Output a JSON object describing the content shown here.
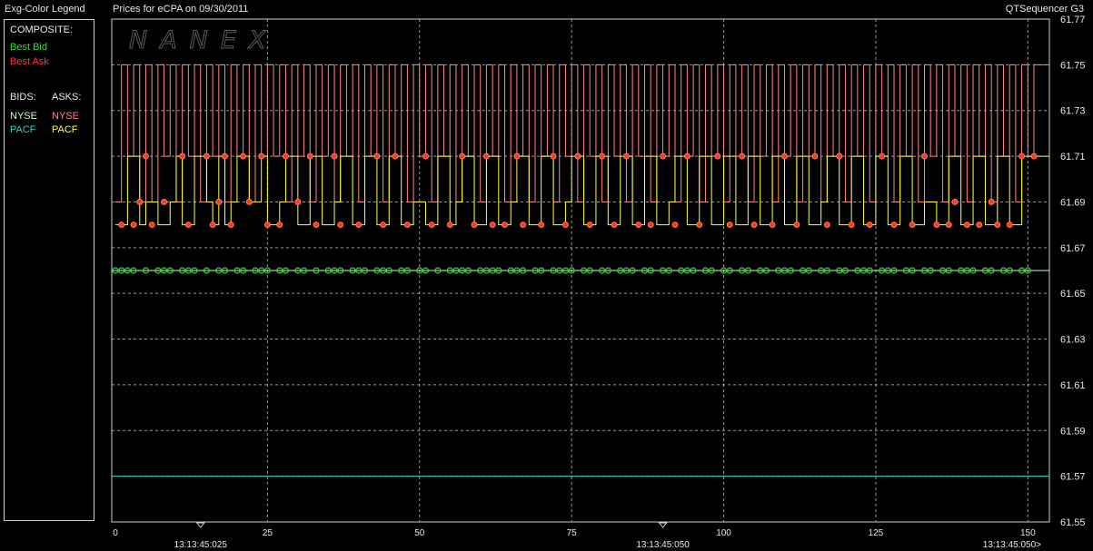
{
  "header": {
    "legend_title": "Exg-Color Legend",
    "chart_title": "Prices for  eCPA  on  09/30/2011",
    "app_name": "QTSequencer G3"
  },
  "legend": {
    "composite_label": "COMPOSITE:",
    "best_bid": "Best Bid",
    "best_ask": "Best Ask",
    "bids_label": "BIDS:",
    "asks_label": "ASKS:",
    "bid_exchanges": [
      "NYSE",
      "PACF"
    ],
    "ask_exchanges": [
      "NYSE",
      "PACF"
    ]
  },
  "colors": {
    "best_bid": "#33dd33",
    "best_ask": "#ff3333",
    "nyse_bid": "#ccffcc",
    "pacf_bid": "#33cccc",
    "nyse_ask": "#ff8888",
    "pacf_ask": "#ffff44",
    "grid": "#cccccc"
  },
  "watermark": "NANEX",
  "chart_data": {
    "type": "line",
    "title": "Prices for  eCPA  on  09/30/2011",
    "xlim": [
      0,
      151
    ],
    "ylim": [
      61.55,
      61.77
    ],
    "y_ticks": [
      "61.77",
      "61.75",
      "61.73",
      "61.71",
      "61.69",
      "61.67",
      "61.65",
      "61.63",
      "61.61",
      "61.59",
      "61.57",
      "61.55"
    ],
    "x_ticks": [
      0,
      25,
      50,
      75,
      100,
      125,
      150
    ],
    "time_labels": [
      {
        "x": 14,
        "label": "13:13:45:025"
      },
      {
        "x": 90,
        "label": "13:13:45:050"
      },
      {
        "x": 151,
        "label": "13:13:45:050>"
      }
    ],
    "grid": true,
    "series": [
      {
        "name": "NYSE",
        "side": "ask",
        "values": [
          61.69,
          61.75,
          61.71,
          61.75,
          61.69,
          61.75,
          61.69,
          61.75,
          61.71,
          61.75,
          61.69,
          61.75,
          61.71,
          61.75,
          61.69,
          61.75,
          61.71,
          61.75,
          61.69,
          61.75,
          61.71,
          61.75,
          61.69,
          61.75,
          61.71,
          61.75,
          61.71,
          61.75,
          61.69,
          61.75,
          61.71,
          61.75,
          61.69,
          61.75,
          61.71,
          61.75,
          61.69,
          61.75,
          61.71,
          61.75,
          61.69,
          61.75,
          61.71,
          61.75,
          61.69,
          61.75,
          61.71,
          61.75,
          61.69,
          61.75,
          61.71,
          61.75,
          61.69,
          61.75,
          61.71,
          61.75,
          61.69,
          61.75,
          61.71,
          61.75,
          61.69,
          61.75,
          61.71,
          61.75,
          61.69,
          61.75,
          61.71,
          61.75,
          61.69,
          61.75,
          61.71,
          61.75,
          61.69,
          61.75,
          61.71,
          61.75,
          61.69,
          61.75,
          61.71,
          61.75,
          61.69,
          61.75,
          61.71,
          61.75,
          61.69,
          61.75,
          61.71,
          61.75,
          61.69,
          61.75,
          61.71,
          61.75,
          61.69,
          61.75,
          61.71,
          61.75,
          61.69,
          61.75,
          61.71,
          61.75,
          61.69,
          61.75,
          61.71,
          61.75,
          61.69,
          61.75,
          61.71,
          61.75,
          61.69,
          61.75,
          61.71,
          61.75,
          61.69,
          61.75,
          61.71,
          61.75,
          61.69,
          61.75,
          61.71,
          61.75,
          61.69,
          61.75,
          61.71,
          61.75,
          61.69,
          61.75,
          61.71,
          61.75,
          61.69,
          61.75,
          61.71,
          61.75,
          61.69,
          61.75,
          61.71,
          61.75,
          61.69,
          61.75,
          61.71,
          61.75,
          61.69,
          61.75,
          61.71,
          61.75,
          61.69,
          61.75,
          61.71,
          61.75,
          61.69,
          61.75,
          61.71,
          61.75
        ]
      },
      {
        "name": "PACF",
        "side": "ask",
        "values": [
          61.68,
          61.68,
          61.71,
          61.71,
          61.68,
          61.69,
          61.69,
          61.68,
          61.68,
          61.69,
          61.71,
          61.68,
          61.68,
          61.71,
          61.71,
          61.69,
          61.68,
          61.71,
          61.68,
          61.69,
          61.71,
          61.71,
          61.69,
          61.69,
          61.71,
          61.68,
          61.68,
          61.69,
          61.71,
          61.71,
          61.68,
          61.68,
          61.71,
          61.71,
          61.68,
          61.68,
          61.69,
          61.71,
          61.71,
          61.68,
          61.68,
          61.71,
          61.71,
          61.68,
          61.68,
          61.71,
          61.71,
          61.68,
          61.68,
          61.69,
          61.69,
          61.68,
          61.68,
          61.71,
          61.71,
          61.68,
          61.69,
          61.71,
          61.71,
          61.68,
          61.68,
          61.71,
          61.71,
          61.68,
          61.68,
          61.69,
          61.71,
          61.71,
          61.68,
          61.68,
          61.71,
          61.71,
          61.68,
          61.68,
          61.69,
          61.71,
          61.71,
          61.68,
          61.68,
          61.71,
          61.71,
          61.68,
          61.68,
          61.71,
          61.71,
          61.68,
          61.68,
          61.71,
          61.71,
          61.68,
          61.68,
          61.69,
          61.71,
          61.71,
          61.68,
          61.68,
          61.71,
          61.71,
          61.68,
          61.68,
          61.71,
          61.71,
          61.68,
          61.68,
          61.71,
          61.71,
          61.68,
          61.68,
          61.71,
          61.71,
          61.68,
          61.68,
          61.71,
          61.71,
          61.68,
          61.68,
          61.69,
          61.71,
          61.71,
          61.68,
          61.68,
          61.71,
          61.71,
          61.68,
          61.68,
          61.71,
          61.71,
          61.68,
          61.68,
          61.71,
          61.71,
          61.68,
          61.68,
          61.69,
          61.69,
          61.68,
          61.68,
          61.71,
          61.71,
          61.68,
          61.68,
          61.71,
          61.71,
          61.68,
          61.68,
          61.71,
          61.71,
          61.68,
          61.68,
          61.71,
          61.71,
          61.71
        ]
      },
      {
        "name": "NYSE",
        "side": "bid",
        "values": [
          61.66,
          61.66
        ]
      },
      {
        "name": "PACF",
        "side": "bid",
        "values": [
          61.57,
          61.57
        ]
      }
    ],
    "best_bid_points": {
      "y": 61.66,
      "x": [
        0,
        1,
        2,
        3,
        5,
        7,
        8,
        9,
        11,
        12,
        13,
        15,
        17,
        18,
        20,
        21,
        23,
        24,
        25,
        27,
        28,
        30,
        31,
        33,
        35,
        36,
        37,
        39,
        40,
        41,
        43,
        44,
        45,
        47,
        48,
        50,
        51,
        53,
        55,
        56,
        57,
        58,
        60,
        61,
        62,
        63,
        65,
        66,
        67,
        69,
        70,
        72,
        73,
        74,
        75,
        77,
        78,
        80,
        81,
        83,
        84,
        85,
        87,
        88,
        90,
        91,
        93,
        94,
        95,
        97,
        98,
        100,
        101,
        103,
        104,
        106,
        107,
        109,
        110,
        111,
        113,
        114,
        116,
        117,
        119,
        120,
        122,
        123,
        124,
        126,
        127,
        128,
        130,
        131,
        133,
        134,
        136,
        137,
        139,
        140,
        141,
        143,
        144,
        146,
        147,
        149,
        150
      ]
    },
    "best_ask_points": [
      [
        1,
        61.68
      ],
      [
        3,
        61.68
      ],
      [
        4,
        61.69
      ],
      [
        5,
        61.71
      ],
      [
        6,
        61.68
      ],
      [
        8,
        61.69
      ],
      [
        11,
        61.71
      ],
      [
        12,
        61.68
      ],
      [
        15,
        61.71
      ],
      [
        16,
        61.68
      ],
      [
        17,
        61.69
      ],
      [
        18,
        61.71
      ],
      [
        19,
        61.68
      ],
      [
        21,
        61.71
      ],
      [
        22,
        61.69
      ],
      [
        24,
        61.71
      ],
      [
        25,
        61.68
      ],
      [
        27,
        61.68
      ],
      [
        28,
        61.71
      ],
      [
        30,
        61.69
      ],
      [
        32,
        61.71
      ],
      [
        33,
        61.68
      ],
      [
        36,
        61.71
      ],
      [
        37,
        61.68
      ],
      [
        40,
        61.68
      ],
      [
        43,
        61.71
      ],
      [
        44,
        61.68
      ],
      [
        46,
        61.71
      ],
      [
        48,
        61.68
      ],
      [
        51,
        61.71
      ],
      [
        52,
        61.68
      ],
      [
        55,
        61.68
      ],
      [
        57,
        61.71
      ],
      [
        59,
        61.68
      ],
      [
        61,
        61.71
      ],
      [
        62,
        61.68
      ],
      [
        64,
        61.68
      ],
      [
        66,
        61.71
      ],
      [
        67,
        61.68
      ],
      [
        70,
        61.68
      ],
      [
        72,
        61.71
      ],
      [
        74,
        61.68
      ],
      [
        76,
        61.71
      ],
      [
        78,
        61.68
      ],
      [
        80,
        61.71
      ],
      [
        82,
        61.68
      ],
      [
        84,
        61.71
      ],
      [
        86,
        61.68
      ],
      [
        88,
        61.68
      ],
      [
        90,
        61.71
      ],
      [
        92,
        61.68
      ],
      [
        94,
        61.71
      ],
      [
        96,
        61.68
      ],
      [
        99,
        61.71
      ],
      [
        101,
        61.68
      ],
      [
        103,
        61.71
      ],
      [
        105,
        61.68
      ],
      [
        108,
        61.68
      ],
      [
        110,
        61.71
      ],
      [
        112,
        61.68
      ],
      [
        115,
        61.71
      ],
      [
        117,
        61.68
      ],
      [
        119,
        61.71
      ],
      [
        121,
        61.68
      ],
      [
        124,
        61.68
      ],
      [
        126,
        61.71
      ],
      [
        128,
        61.68
      ],
      [
        131,
        61.68
      ],
      [
        133,
        61.71
      ],
      [
        135,
        61.68
      ],
      [
        137,
        61.68
      ],
      [
        138,
        61.69
      ],
      [
        140,
        61.68
      ],
      [
        142,
        61.68
      ],
      [
        144,
        61.69
      ],
      [
        145,
        61.68
      ],
      [
        147,
        61.68
      ],
      [
        149,
        61.71
      ],
      [
        151,
        61.71
      ]
    ]
  }
}
